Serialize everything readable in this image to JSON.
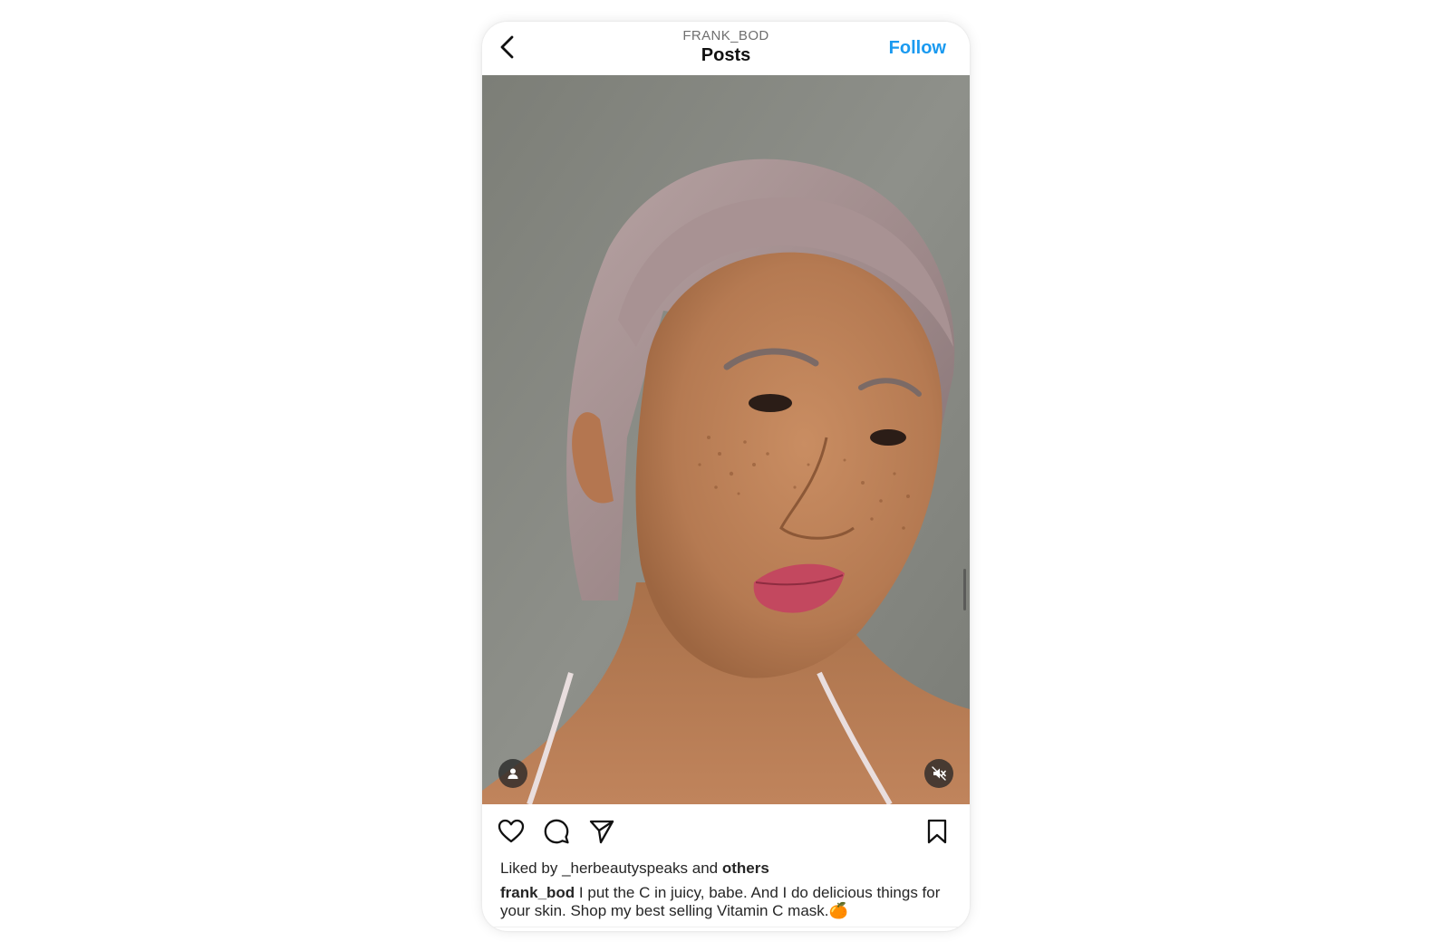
{
  "header": {
    "username": "FRANK_BOD",
    "title": "Posts",
    "follow_label": "Follow"
  },
  "post": {
    "liked_prefix": "Liked by",
    "liked_user": "_herbeautyspeaks",
    "liked_and": "and",
    "liked_others": "others",
    "caption_author": "frank_bod",
    "caption_text": "I put the C in juicy, babe. And I do delicious things for your skin. Shop my best selling Vitamin C mask.🍊"
  },
  "icons": {
    "back": "chevron-left-icon",
    "tag": "user-tag-icon",
    "mute": "muted-speaker-icon",
    "like": "heart-icon",
    "comment": "comment-bubble-icon",
    "share": "paper-plane-icon",
    "save": "bookmark-icon"
  },
  "colors": {
    "accent": "#1a9af0",
    "text": "#262626",
    "muted_text": "#6f6f6f",
    "photo_background": "#868882"
  }
}
